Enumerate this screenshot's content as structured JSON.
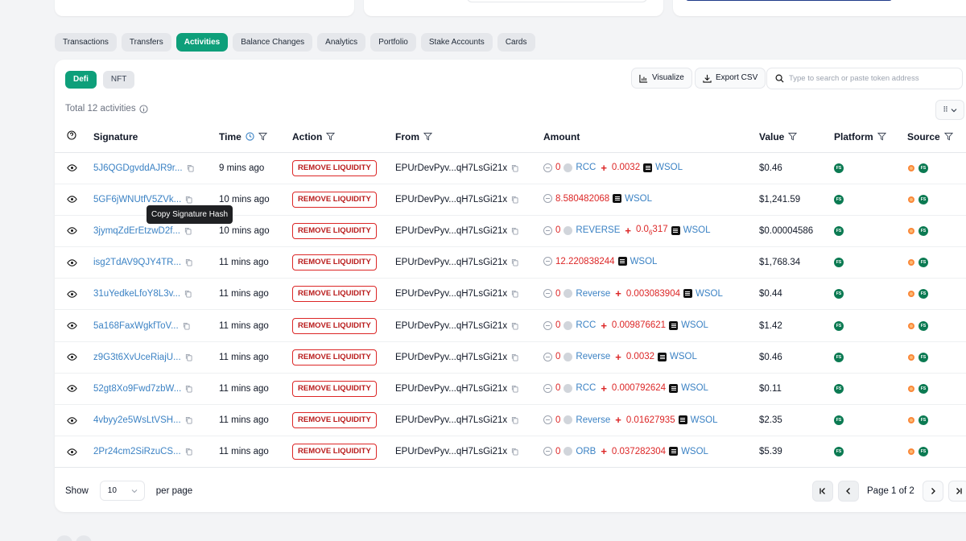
{
  "tabs": [
    "Transactions",
    "Transfers",
    "Activities",
    "Balance Changes",
    "Analytics",
    "Portfolio",
    "Stake Accounts",
    "Cards"
  ],
  "active_tab": "Activities",
  "subtabs": [
    "Defi",
    "NFT"
  ],
  "toolbar": {
    "visualize_label": "Visualize",
    "export_label": "Export CSV",
    "search_placeholder": "Type to search or paste token address"
  },
  "summary": {
    "total_text": "Total 12 activities"
  },
  "columns": {
    "signature": "Signature",
    "time": "Time",
    "action": "Action",
    "from": "From",
    "amount": "Amount",
    "value": "Value",
    "platform": "Platform",
    "source": "Source"
  },
  "rows": [
    {
      "sig": "5J6QGDgvddAJR9r...",
      "time": "9 mins ago",
      "action": "REMOVE LIQUIDITY",
      "from": "EPUrDevPyv...qH7LsGi21x",
      "amt_a": "0",
      "tok_a": "RCC",
      "amt_b": "0.0032",
      "tok_b": "WSOL",
      "value": "$0.46"
    },
    {
      "sig": "5GF6jWNUtfV5ZVk...",
      "time": "10 mins ago",
      "action": "REMOVE LIQUIDITY",
      "from": "EPUrDevPyv...qH7LsGi21x",
      "amt_a": "",
      "tok_a": "",
      "amt_b": "8.580482068",
      "tok_b": "WSOL",
      "value": "$1,241.59"
    },
    {
      "sig": "3jymqZdErEtzwD2f...",
      "time": "10 mins ago",
      "action": "REMOVE LIQUIDITY",
      "from": "EPUrDevPyv...qH7LsGi21x",
      "amt_a": "0",
      "tok_a": "REVERSE",
      "amt_b": "0.0",
      "amt_b_sub": "6",
      "amt_b_tail": "317",
      "tok_b": "WSOL",
      "value": "$0.00004586"
    },
    {
      "sig": "isg2TdAV9QJY4TR...",
      "time": "11 mins ago",
      "action": "REMOVE LIQUIDITY",
      "from": "EPUrDevPyv...qH7LsGi21x",
      "amt_a": "",
      "tok_a": "",
      "amt_b": "12.220838244",
      "tok_b": "WSOL",
      "value": "$1,768.34"
    },
    {
      "sig": "31uYedkeLfoY8L3v...",
      "time": "11 mins ago",
      "action": "REMOVE LIQUIDITY",
      "from": "EPUrDevPyv...qH7LsGi21x",
      "amt_a": "0",
      "tok_a": "Reverse",
      "amt_b": "0.003083904",
      "tok_b": "WSOL",
      "value": "$0.44"
    },
    {
      "sig": "5a168FaxWgkfToV...",
      "time": "11 mins ago",
      "action": "REMOVE LIQUIDITY",
      "from": "EPUrDevPyv...qH7LsGi21x",
      "amt_a": "0",
      "tok_a": "RCC",
      "amt_b": "0.009876621",
      "tok_b": "WSOL",
      "value": "$1.42"
    },
    {
      "sig": "z9G3t6XvUceRiajU...",
      "time": "11 mins ago",
      "action": "REMOVE LIQUIDITY",
      "from": "EPUrDevPyv...qH7LsGi21x",
      "amt_a": "0",
      "tok_a": "Reverse",
      "amt_b": "0.0032",
      "tok_b": "WSOL",
      "value": "$0.46"
    },
    {
      "sig": "52gt8Xo9Fwd7zbW...",
      "time": "11 mins ago",
      "action": "REMOVE LIQUIDITY",
      "from": "EPUrDevPyv...qH7LsGi21x",
      "amt_a": "0",
      "tok_a": "RCC",
      "amt_b": "0.000792624",
      "tok_b": "WSOL",
      "value": "$0.11"
    },
    {
      "sig": "4vbyy2e5WsLtVSH...",
      "time": "11 mins ago",
      "action": "REMOVE LIQUIDITY",
      "from": "EPUrDevPyv...qH7LsGi21x",
      "amt_a": "0",
      "tok_a": "Reverse",
      "amt_b": "0.01627935",
      "tok_b": "WSOL",
      "value": "$2.35"
    },
    {
      "sig": "2Pr24cm2SiRzuCS...",
      "time": "11 mins ago",
      "action": "REMOVE LIQUIDITY",
      "from": "EPUrDevPyv...qH7LsGi21x",
      "amt_a": "0",
      "tok_a": "ORB",
      "amt_b": "0.037282304",
      "tok_b": "WSOL",
      "value": "$5.39"
    }
  ],
  "platform_logo_text": "FS",
  "tooltip": "Copy Signature Hash",
  "pagination": {
    "show_label": "Show",
    "page_size": "10",
    "per_page_label": "per page",
    "page_text": "Page 1 of 2"
  },
  "colors": {
    "accent": "#0e9f7a",
    "link": "#3b82c4",
    "negative": "#dc2626"
  }
}
